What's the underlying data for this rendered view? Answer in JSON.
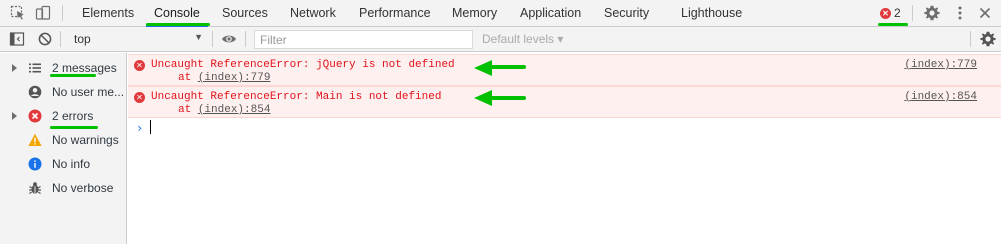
{
  "tabs": [
    {
      "label": "Elements",
      "active": false
    },
    {
      "label": "Console",
      "active": true
    },
    {
      "label": "Sources",
      "active": false
    },
    {
      "label": "Network",
      "active": false
    },
    {
      "label": "Performance",
      "active": false
    },
    {
      "label": "Memory",
      "active": false
    },
    {
      "label": "Application",
      "active": false
    },
    {
      "label": "Security",
      "active": false
    },
    {
      "label": "Lighthouse",
      "active": false
    }
  ],
  "error_badge": {
    "icon": "error-icon",
    "count": "2"
  },
  "toolbar": {
    "context": "top",
    "filter_placeholder": "Filter",
    "levels_label": "Default levels ▾"
  },
  "sidebar": {
    "items": [
      {
        "label": "2 messages",
        "icon": "list-icon",
        "expandable": true
      },
      {
        "label": "No user me...",
        "icon": "user-icon",
        "expandable": false
      },
      {
        "label": "2 errors",
        "icon": "error-icon",
        "expandable": true
      },
      {
        "label": "No warnings",
        "icon": "warning-icon",
        "expandable": false
      },
      {
        "label": "No info",
        "icon": "info-icon",
        "expandable": false
      },
      {
        "label": "No verbose",
        "icon": "bug-icon",
        "expandable": false
      }
    ]
  },
  "messages": [
    {
      "text": "Uncaught ReferenceError: jQuery is not defined",
      "at_prefix": "at ",
      "at_link": "(index):779",
      "source": "(index):779"
    },
    {
      "text": "Uncaught ReferenceError: Main is not defined",
      "at_prefix": "at ",
      "at_link": "(index):854",
      "source": "(index):854"
    }
  ],
  "prompt_symbol": "›",
  "colors": {
    "accent": "#1a73e8",
    "error": "#e0393e",
    "error_text": "#e0121a",
    "annotation": "#00c000"
  }
}
